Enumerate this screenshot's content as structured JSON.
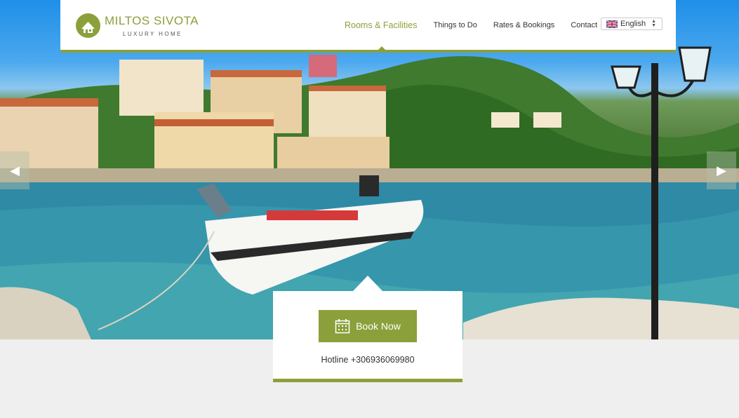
{
  "logo": {
    "title": "MILTOS SIVOTA",
    "subtitle": "LUXURY HOME"
  },
  "nav": [
    {
      "label": "Rooms & Facilities",
      "active": true
    },
    {
      "label": "Things to Do",
      "active": false
    },
    {
      "label": "Rates & Bookings",
      "active": false
    },
    {
      "label": "Contact",
      "active": false
    }
  ],
  "language": {
    "selected": "English",
    "icon": "uk-flag-icon"
  },
  "slider": {
    "prev_icon": "chevron-left-icon",
    "next_icon": "chevron-right-icon",
    "prev_glyph": "◀",
    "next_glyph": "▶"
  },
  "booking": {
    "button_label": "Book Now",
    "button_icon": "calendar-icon",
    "hotline": "Hotline +306936069980"
  },
  "colors": {
    "accent": "#8ba03b",
    "background": "#efefef"
  }
}
